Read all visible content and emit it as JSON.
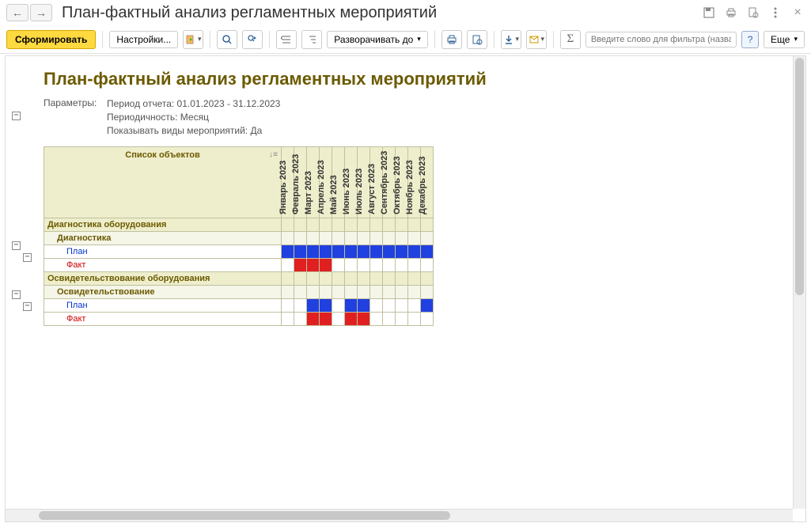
{
  "header": {
    "title": "План-фактный анализ регламентных мероприятий",
    "nav_back": "←",
    "nav_fwd": "→"
  },
  "toolbar": {
    "generate": "Сформировать",
    "settings": "Настройки...",
    "expand_to": "Разворачивать до",
    "filter_placeholder": "Введите слово для фильтра (название товара, пок...",
    "more": "Еще"
  },
  "report": {
    "title": "План-фактный анализ регламентных мероприятий",
    "params_label": "Параметры:",
    "params": [
      "Период отчета: 01.01.2023 - 31.12.2023",
      "Периодичность: Месяц",
      "Показывать виды мероприятий: Да"
    ],
    "objects_header": "Список объектов",
    "months": [
      "Январь 2023",
      "Февраль 2023",
      "Март 2023",
      "Апрель 2023",
      "Май 2023",
      "Июнь 2023",
      "Июль 2023",
      "Август 2023",
      "Сентябрь 2023",
      "Октябрь 2023",
      "Ноябрь 2023",
      "Декабрь 2023"
    ],
    "groups": [
      {
        "name": "Диагностика оборудования",
        "sub": "Диагностика",
        "plan_label": "План",
        "fact_label": "Факт",
        "plan": [
          1,
          1,
          1,
          1,
          1,
          1,
          1,
          1,
          1,
          1,
          1,
          1
        ],
        "fact": [
          0,
          1,
          1,
          1,
          0,
          0,
          0,
          0,
          0,
          0,
          0,
          0
        ]
      },
      {
        "name": "Освидетельствование оборудования",
        "sub": "Освидетельствование",
        "plan_label": "План",
        "fact_label": "Факт",
        "plan": [
          0,
          0,
          1,
          1,
          0,
          1,
          1,
          0,
          0,
          0,
          0,
          1
        ],
        "fact": [
          0,
          0,
          1,
          1,
          0,
          1,
          1,
          0,
          0,
          0,
          0,
          0
        ]
      }
    ]
  },
  "chart_data": {
    "type": "table",
    "title": "План-фактный анализ регламентных мероприятий",
    "columns": [
      "Январь 2023",
      "Февраль 2023",
      "Март 2023",
      "Апрель 2023",
      "Май 2023",
      "Июнь 2023",
      "Июль 2023",
      "Август 2023",
      "Сентябрь 2023",
      "Октябрь 2023",
      "Ноябрь 2023",
      "Декабрь 2023"
    ],
    "rows": [
      {
        "group": "Диагностика оборудования",
        "type": "Диагностика",
        "series": "План",
        "values": [
          1,
          1,
          1,
          1,
          1,
          1,
          1,
          1,
          1,
          1,
          1,
          1
        ]
      },
      {
        "group": "Диагностика оборудования",
        "type": "Диагностика",
        "series": "Факт",
        "values": [
          0,
          1,
          1,
          1,
          0,
          0,
          0,
          0,
          0,
          0,
          0,
          0
        ]
      },
      {
        "group": "Освидетельствование оборудования",
        "type": "Освидетельствование",
        "series": "План",
        "values": [
          0,
          0,
          1,
          1,
          0,
          1,
          1,
          0,
          0,
          0,
          0,
          1
        ]
      },
      {
        "group": "Освидетельствование оборудования",
        "type": "Освидетельствование",
        "series": "Факт",
        "values": [
          0,
          0,
          1,
          1,
          0,
          1,
          1,
          0,
          0,
          0,
          0,
          0
        ]
      }
    ],
    "legend": {
      "План": "blue",
      "Факт": "red"
    }
  }
}
